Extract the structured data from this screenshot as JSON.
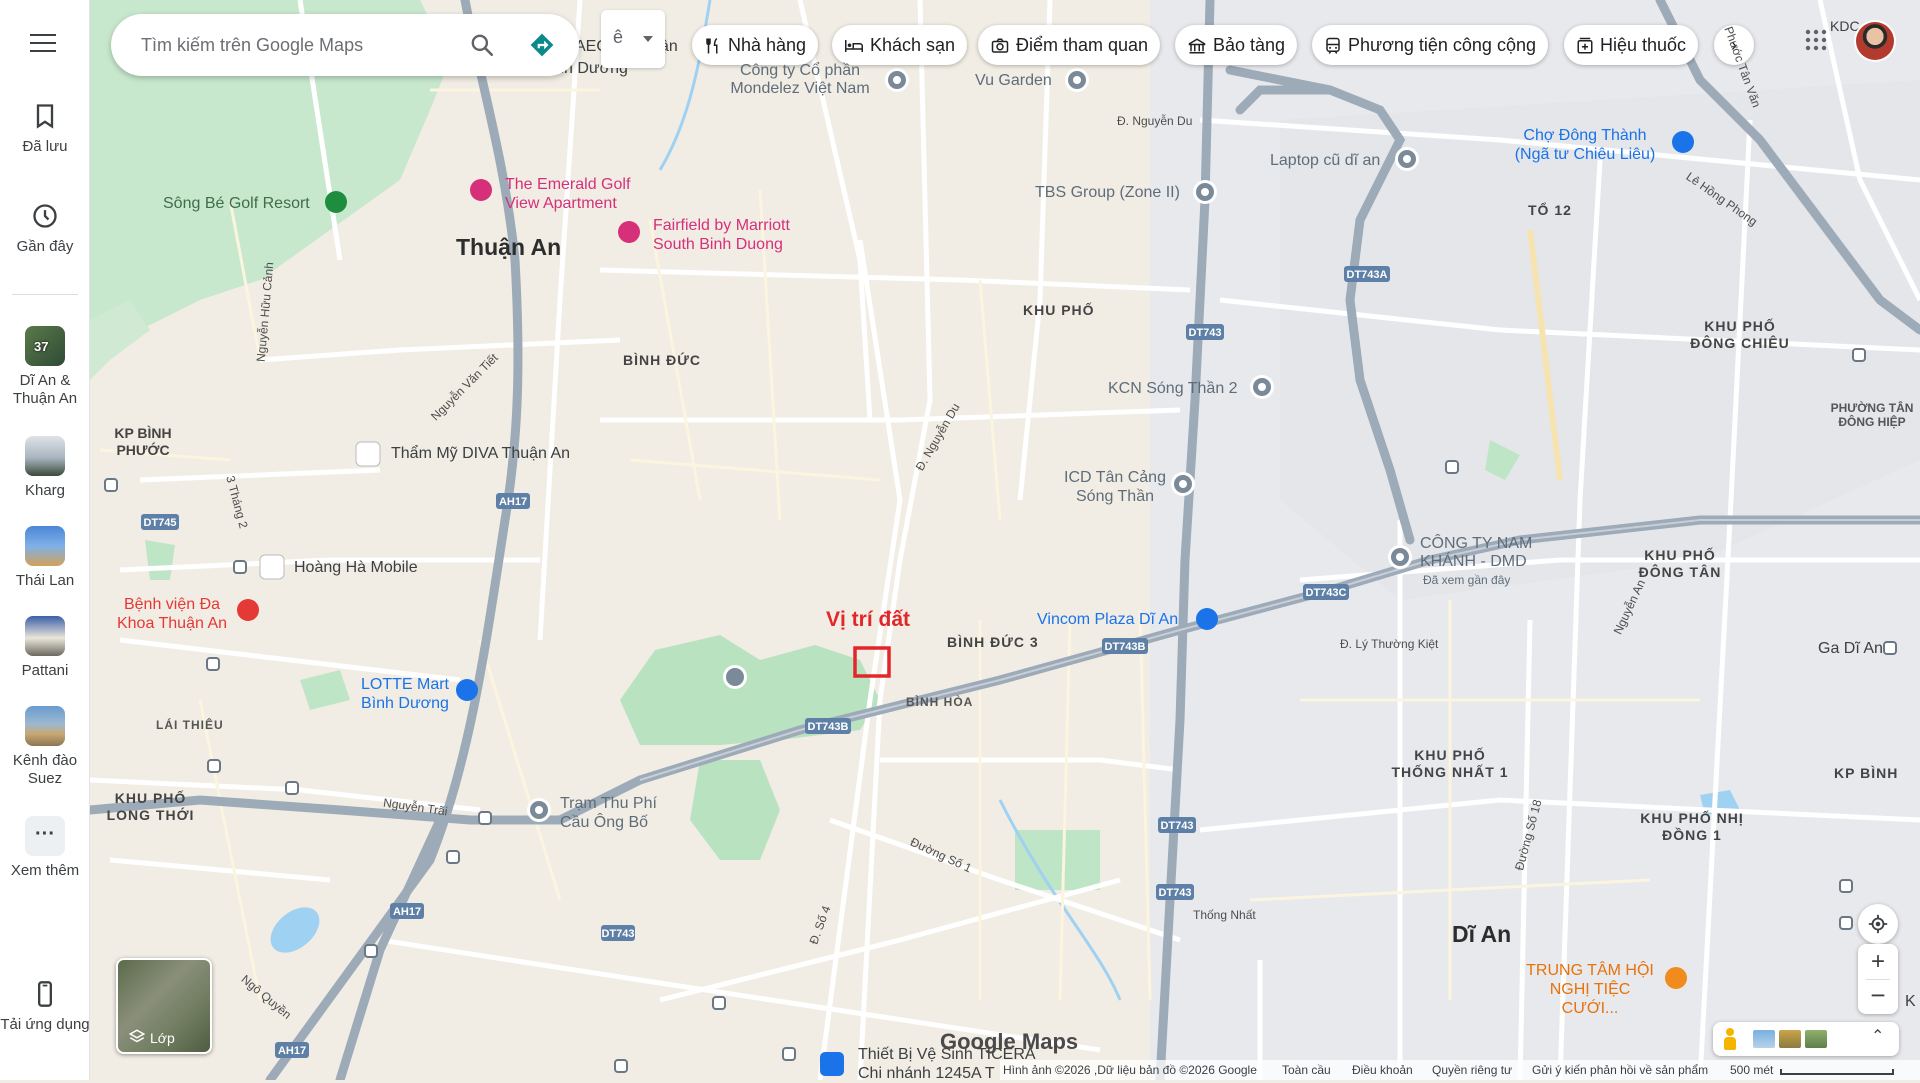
{
  "sidebar": {
    "menu_icon": "menu-icon",
    "items": [
      {
        "label": "Đã lưu",
        "icon": "bookmark-icon"
      },
      {
        "label": "Gần đây",
        "icon": "history-icon"
      },
      {
        "label": "Dĩ An & Thuận An",
        "badge": "37"
      },
      {
        "label": "Kharg"
      },
      {
        "label": "Thái Lan"
      },
      {
        "label": "Pattani"
      },
      {
        "label": "Kênh đào Suez"
      },
      {
        "label": "Xem thêm",
        "icon": "more-icon"
      },
      {
        "label": "Tải ứng dụng",
        "icon": "phone-icon"
      }
    ]
  },
  "search": {
    "placeholder": "Tìm kiếm trên Google Maps"
  },
  "chips": {
    "restaurants": "Nhà hàng",
    "hotels": "Khách sạn",
    "attractions": "Điểm tham quan",
    "museums": "Bảo tàng",
    "transit": "Phương tiện công cộng",
    "pharmacy": "Hiệu thuốc"
  },
  "account": {
    "label": "KDC"
  },
  "map": {
    "places": {
      "aeon": "AEON",
      "aeon_tail": "ận",
      "binh_duong_top": "Bình Dương",
      "mondelez": "Công ty Cổ phần Mondelez Việt Nam",
      "vu_garden": "Vu Garden",
      "nguyen_du": "Đ. Nguyễn Du",
      "laptop": "Laptop cũ dĩ an",
      "cho_dong_thanh": "Chợ Đông Thành (Ngã tư Chiêu Liêu)",
      "tbs": "TBS Group (Zone II)",
      "to12": "TỔ 12",
      "emerald": "The Emerald Golf View Apartment",
      "fairfield": "Fairfield by Marriott South Binh Duong",
      "song_be": "Sông Bé Golf Resort",
      "thuan_an": "Thuận An",
      "binh_duc": "BÌNH ĐỨC",
      "khu_pho": "KHU PHỐ",
      "kp_dong_chieu": "KHU PHỐ ĐÔNG CHIÊU",
      "phuong_tan_dong_hiep": "PHƯỜNG TÂN ĐÔNG HIỆP",
      "kp_binh_phuoc": "KP BÌNH PHƯỚC",
      "diva": "Thẩm Mỹ DIVA Thuận An",
      "kcn": "KCN Sóng Thần 2",
      "icd": "ICD Tân Cảng Sóng Thần",
      "cong_ty_nam": "CÔNG TY NAM KHÁNH - DMD",
      "cong_ty_sub": "Đã xem gần đây",
      "kp_dong_tan": "KHU PHỐ ĐÔNG TÂN",
      "hoang_ha": "Hoàng Hà Mobile",
      "benh_vien": "Bệnh viện Đa Khoa Thuận An",
      "vincom": "Vincom Plaza Dĩ An",
      "ly_thuong_kiet": "Đ. Lý Thường Kiệt",
      "ga_di_an": "Ga Dĩ An",
      "binh_duc_3": "BÌNH ĐỨC 3",
      "binh_hoa": "BÌNH HÒA",
      "lotte": "LOTTE Mart Bình Dương",
      "lai_thieu": "LÁI THIÊU",
      "kp_thong_nhat": "KHU PHỐ THỐNG NHẤT 1",
      "kp_binh": "KP BÌNH",
      "kp_long_thoi": "KHU PHỐ LONG THỚI",
      "tram_thu_phi": "Trạm Thu Phí Cầu Ông Bố",
      "kp_nhi_dong": "KHU PHỐ NHỊ ĐỒNG 1",
      "thong_nhat": "Thống Nhất",
      "di_an": "Dĩ An",
      "trung_tam": "TRUNG TÂM HỘI NGHỊ TIỆC CƯỚI...",
      "thiet_bi": "Thiết Bị Vệ Sinh TICERA Chi nhánh 1245A T",
      "nguyen_trai": "Nguyễn Trãi",
      "duong_so_1": "Đường Số 1",
      "d_so_4": "Đ. Số 4",
      "duong_so_18": "Đường Số 18",
      "ngo_quyen": "Ngô Quyền",
      "nguyen_du_road": "Đ. Nguyễn Du",
      "nguyen_van_tiet": "Nguyễn Văn Tiết",
      "nguyen_huu_canh": "Nguyễn Hữu Cảnh",
      "thang_2": "3 Tháng 2",
      "le_hong_phong": "Lê Hồng Phong",
      "phuoc_tan_van": "Phước Tân Văn",
      "nguyen_an": "Nguyễn An",
      "k_edge": "K"
    },
    "shields": [
      "DT743A",
      "DT743",
      "DT745",
      "AH17",
      "DT743B",
      "DT743C",
      "DT743B",
      "AH17",
      "DT743",
      "DT743",
      "DT743",
      "AH17"
    ],
    "annotation": "Vị trí đất",
    "layers_label": "Lớp",
    "logo": "Google Maps"
  },
  "footer": {
    "imagery": "Hình ảnh ©2026 ,Dữ liệu bản đồ ©2026 Google",
    "global": "Toàn cầu",
    "terms": "Điều khoản",
    "privacy": "Quyền riêng tư",
    "feedback": "Gửi ý kiến phản hồi về sản phẩm",
    "scale": "500 mét"
  },
  "colors": {
    "land": "#f1ede4",
    "road": "#ffffff",
    "highway": "#9aa7b5",
    "park": "#bfe5c7",
    "water": "#9fd1f2",
    "poi_pink": "#d6307a",
    "poi_blue": "#1a73e8",
    "annotation_red": "#e3262a"
  }
}
